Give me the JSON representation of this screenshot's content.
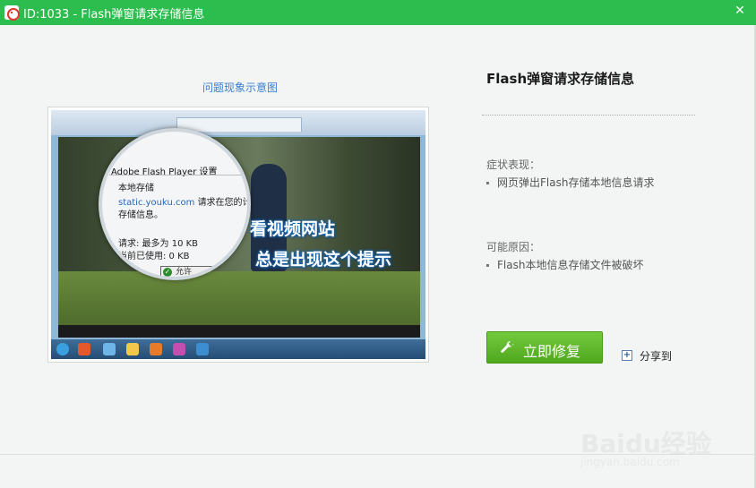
{
  "window": {
    "title": "ID:1033 - Flash弹窗请求存储信息",
    "close_glyph": "✕",
    "accent_color": "#2dbd4f"
  },
  "preview": {
    "caption": "问题现象示意图",
    "dialog_title": "Adobe Flash Player 设置",
    "dialog_heading": "本地存储",
    "dialog_domain": "static.youku.com",
    "dialog_request": "请求在您的计",
    "dialog_line2": "存储信息。",
    "dialog_request_size": "请求: 最多为 10 KB",
    "dialog_used": "当前已使用: 0 KB",
    "dialog_allow": "允许",
    "overlay_line1": "看视频网站",
    "overlay_line2": "总是出现这个提示"
  },
  "info": {
    "title": "Flash弹窗请求存储信息",
    "symptom_label": "症状表现：",
    "symptom_items": [
      "网页弹出Flash存储本地信息请求"
    ],
    "cause_label": "可能原因：",
    "cause_items": [
      "Flash本地信息存储文件被破坏"
    ]
  },
  "actions": {
    "fix_label": "立即修复",
    "share_label": "分享到",
    "fix_color": "#5cb82a"
  },
  "watermark": {
    "brand": "Baidu经验",
    "url": "jingyan.baidu.com"
  }
}
